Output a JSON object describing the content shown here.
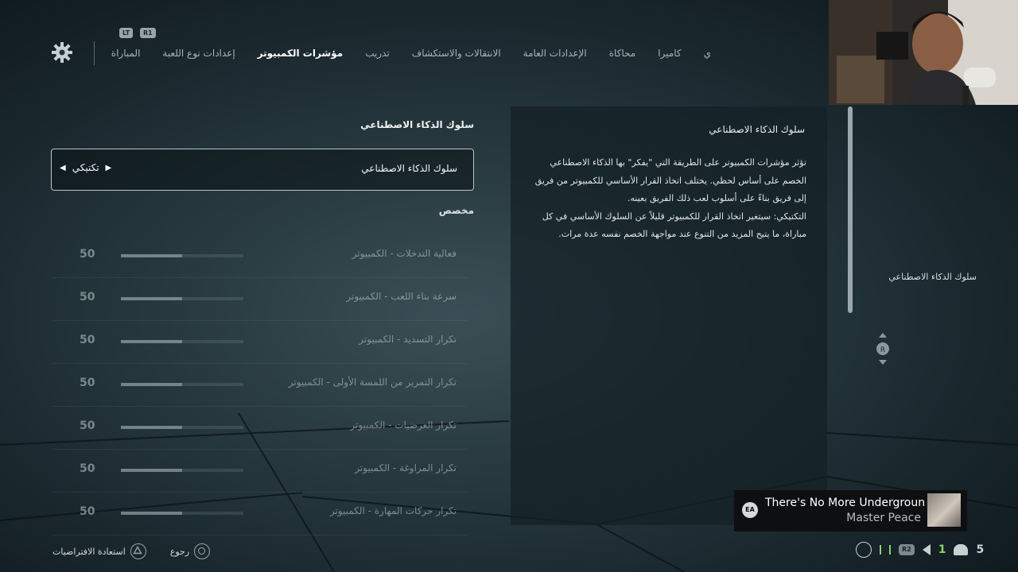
{
  "header": {
    "bumper_left": "LT",
    "bumper_right": "R1",
    "tabs": [
      {
        "label": "ي"
      },
      {
        "label": "كاميرا"
      },
      {
        "label": "محاكاة"
      },
      {
        "label": "الإعدادات العامة"
      },
      {
        "label": "الانتقالات والاستكشاف"
      },
      {
        "label": "تدريب"
      },
      {
        "label": "مؤشرات الكمبيوتر",
        "active": true
      },
      {
        "label": "إعدادات نوع اللعبة"
      },
      {
        "label": "المباراة"
      }
    ]
  },
  "left": {
    "section_title": "سلوك الذكاء الاصطناعي",
    "selector": {
      "label": "سلوك الذكاء الاصطناعي",
      "value": "تكتيكي"
    },
    "custom_label": "مخصص",
    "sliders": [
      {
        "label": "فعالية التدخلات - الكمبيوتر",
        "value": "50",
        "level": 0.5
      },
      {
        "label": "سرعة بناء اللعب - الكمبيوتر",
        "value": "50",
        "level": 0.5
      },
      {
        "label": "تكرار التسديد - الكمبيوتر",
        "value": "50",
        "level": 0.5
      },
      {
        "label": "تكرار التمرير من اللمسة الأولى - الكمبيوتر",
        "value": "50",
        "level": 0.5
      },
      {
        "label": "تكرار العرضيات - الكمبيوتر",
        "value": "50",
        "level": 0.5
      },
      {
        "label": "تكرار المراوغة - الكمبيوتر",
        "value": "50",
        "level": 0.5
      },
      {
        "label": "تكرار حركات المهارة - الكمبيوتر",
        "value": "50",
        "level": 0.5
      }
    ]
  },
  "description": {
    "title": "سلوك الذكاء الاصطناعي",
    "body1": "تؤثر مؤشرات الكمبيوتر على الطريقة التي \"يفكر\" بها الذكاء الاصطناعي الخصم على أساس لحظي. يختلف اتخاذ القرار الأساسي للكمبيوتر من فريق إلى فريق بناءً على أسلوب لعب ذلك الفريق بعينه.",
    "body2": "التكتيكي: سيتغير اتخاذ القرار للكمبيوتر قليلاً عن السلوك الأساسي في كل مباراة، ما يتيح المزيد من التنوع عند مواجهة الخصم نفسه عدة مرات."
  },
  "side_label": "سلوك الذكاء الاصطناعي",
  "rstick_label": "R",
  "footer": {
    "back": "رجوع",
    "restore": "استعادة الافتراضيات"
  },
  "now_playing": {
    "logo": "EA",
    "title": "There's No More Underground",
    "artist": "Master Peace"
  },
  "status": {
    "r2": "R2",
    "count1": "1",
    "count2": "5"
  }
}
